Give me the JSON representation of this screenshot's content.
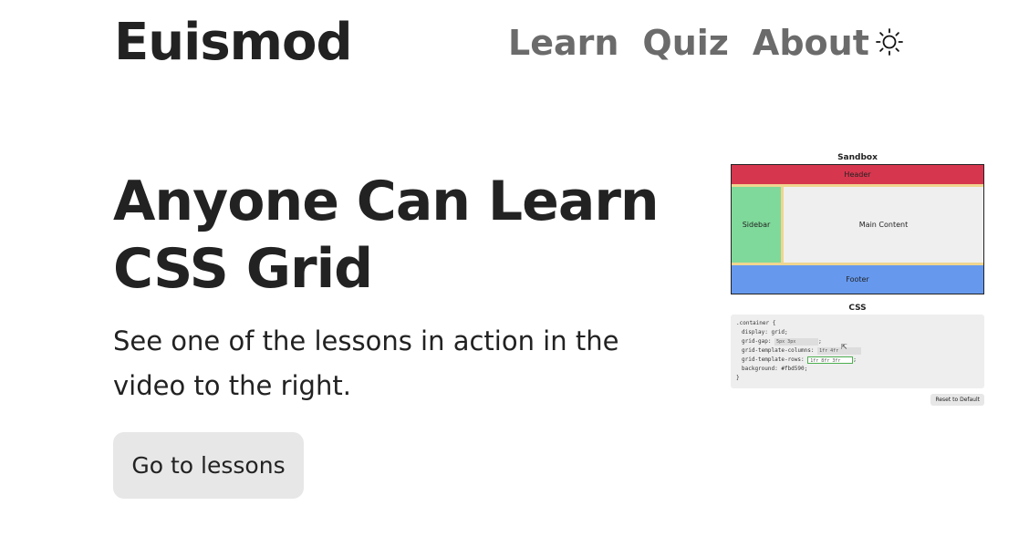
{
  "header": {
    "brand": "Euismod",
    "nav": [
      {
        "label": "Learn"
      },
      {
        "label": "Quiz"
      },
      {
        "label": "About"
      }
    ],
    "theme_toggle_icon": "sun-icon"
  },
  "hero": {
    "title_line1": "Anyone Can Learn",
    "title_line2": "CSS Grid",
    "subtitle": "See one of the lessons in action in the video to the right.",
    "cta_label": "Go to lessons"
  },
  "demo": {
    "sandbox_title": "Sandbox",
    "areas": {
      "header": "Header",
      "sidebar": "Sidebar",
      "main": "Main Content",
      "footer": "Footer"
    },
    "css_title": "CSS",
    "code": {
      "selector": ".container {",
      "display": "display: grid;",
      "gap_prop": "grid-gap:",
      "gap_value": "5px 3px",
      "cols_prop": "grid-template-columns:",
      "cols_value": "1fr 4fr",
      "rows_prop": "grid-template-rows:",
      "rows_value": "1fr 8fr 3fr",
      "background": "background: #fbd590;",
      "close": "}"
    },
    "reset_label": "Reset to Default",
    "colors": {
      "header": "#d6374e",
      "sidebar": "#7fd99a",
      "main": "#efefef",
      "footer": "#6699ee",
      "gap": "#f0d590"
    }
  }
}
